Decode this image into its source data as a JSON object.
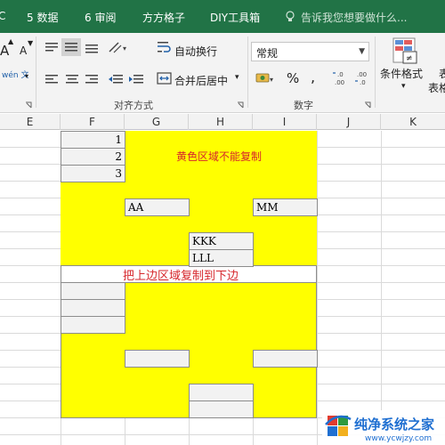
{
  "tabs": [
    "5 数据",
    "6 审阅",
    "方方格子",
    "DIY工具箱"
  ],
  "tab_left_fragment": "C",
  "tell_me": "告诉我您想要做什么...",
  "ribbon": {
    "font_group": {
      "increase": "A",
      "decrease": "A",
      "phonetic": "wén 文"
    },
    "alignment": {
      "wrap": "自动换行",
      "merge": "合并后居中",
      "group_label": "对齐方式"
    },
    "number": {
      "format_value": "常规",
      "percent": "%",
      "comma": ",",
      "inc_decimal": ".00",
      "dec_decimal": ".00",
      "group_label": "数字",
      "currency": "¥"
    },
    "styles": {
      "conditional": "条件格式",
      "table_fragment": "表",
      "table_fragment2": "表格"
    }
  },
  "columns": [
    "E",
    "F",
    "G",
    "H",
    "I",
    "J",
    "K"
  ],
  "cells": {
    "n1": "1",
    "n2": "2",
    "n3": "3",
    "aa": "AA",
    "mm": "MM",
    "kkk": "KKK",
    "lll": "LLL"
  },
  "notes": {
    "top": "黄色区域不能复制",
    "band": "把上边区域复制到下边"
  },
  "colors": {
    "tab_bar": "#217346",
    "highlight": "#ffff00",
    "note_text": "#d6262b"
  },
  "watermark": {
    "name": "纯净系统之家",
    "url": "www.ycwjzy.com"
  }
}
